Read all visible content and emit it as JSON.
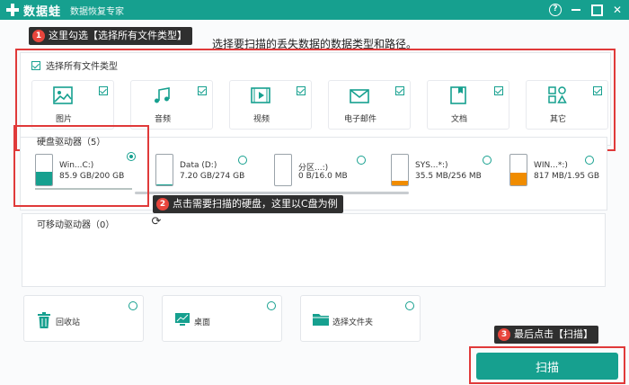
{
  "app": {
    "name": "数据蛙",
    "subtitle": "数据恢复专家"
  },
  "window_controls": {
    "help": "?"
  },
  "callouts": [
    {
      "num": "1",
      "text": "这里勾选【选择所有文件类型】"
    },
    {
      "num": "2",
      "text": "点击需要扫描的硬盘，这里以C盘为例"
    },
    {
      "num": "3",
      "text": "最后点击【扫描】"
    }
  ],
  "hint": "选择要扫描的丢失数据的数据类型和路径。",
  "file_types": {
    "select_all_label": "选择所有文件类型",
    "items": [
      {
        "label": "图片",
        "icon": "image-icon"
      },
      {
        "label": "音频",
        "icon": "music-icon"
      },
      {
        "label": "视频",
        "icon": "video-icon"
      },
      {
        "label": "电子邮件",
        "icon": "email-icon"
      },
      {
        "label": "文档",
        "icon": "document-icon"
      },
      {
        "label": "其它",
        "icon": "other-icon"
      }
    ]
  },
  "hard_drives": {
    "title": "硬盘驱动器（5）",
    "items": [
      {
        "name": "Win...C:)",
        "size": "85.9 GB/200 GB",
        "fill": 0.43,
        "color": "#16a08f",
        "selected": true
      },
      {
        "name": "Data (D:)",
        "size": "7.20 GB/274 GB",
        "fill": 0.03,
        "color": "#16a08f",
        "selected": false
      },
      {
        "name": "分区...:)",
        "size": "0 B/16.0 MB",
        "fill": 0.0,
        "color": "#16a08f",
        "selected": false
      },
      {
        "name": "SYS...*:)",
        "size": "35.5 MB/256 MB",
        "fill": 0.14,
        "color": "#f08c00",
        "selected": false
      },
      {
        "name": "WIN...*:)",
        "size": "817 MB/1.95 GB",
        "fill": 0.42,
        "color": "#f08c00",
        "selected": false
      }
    ]
  },
  "removable_drives": {
    "title": "可移动驱动器（0）"
  },
  "locations": [
    {
      "label": "回收站",
      "icon": "recycle-bin-icon"
    },
    {
      "label": "桌面",
      "icon": "desktop-icon"
    },
    {
      "label": "选择文件夹",
      "icon": "folder-icon"
    }
  ],
  "scan_button": "扫描",
  "colors": {
    "brand": "#16a08f",
    "warning": "#f08c00",
    "highlight": "#e03a3a"
  }
}
